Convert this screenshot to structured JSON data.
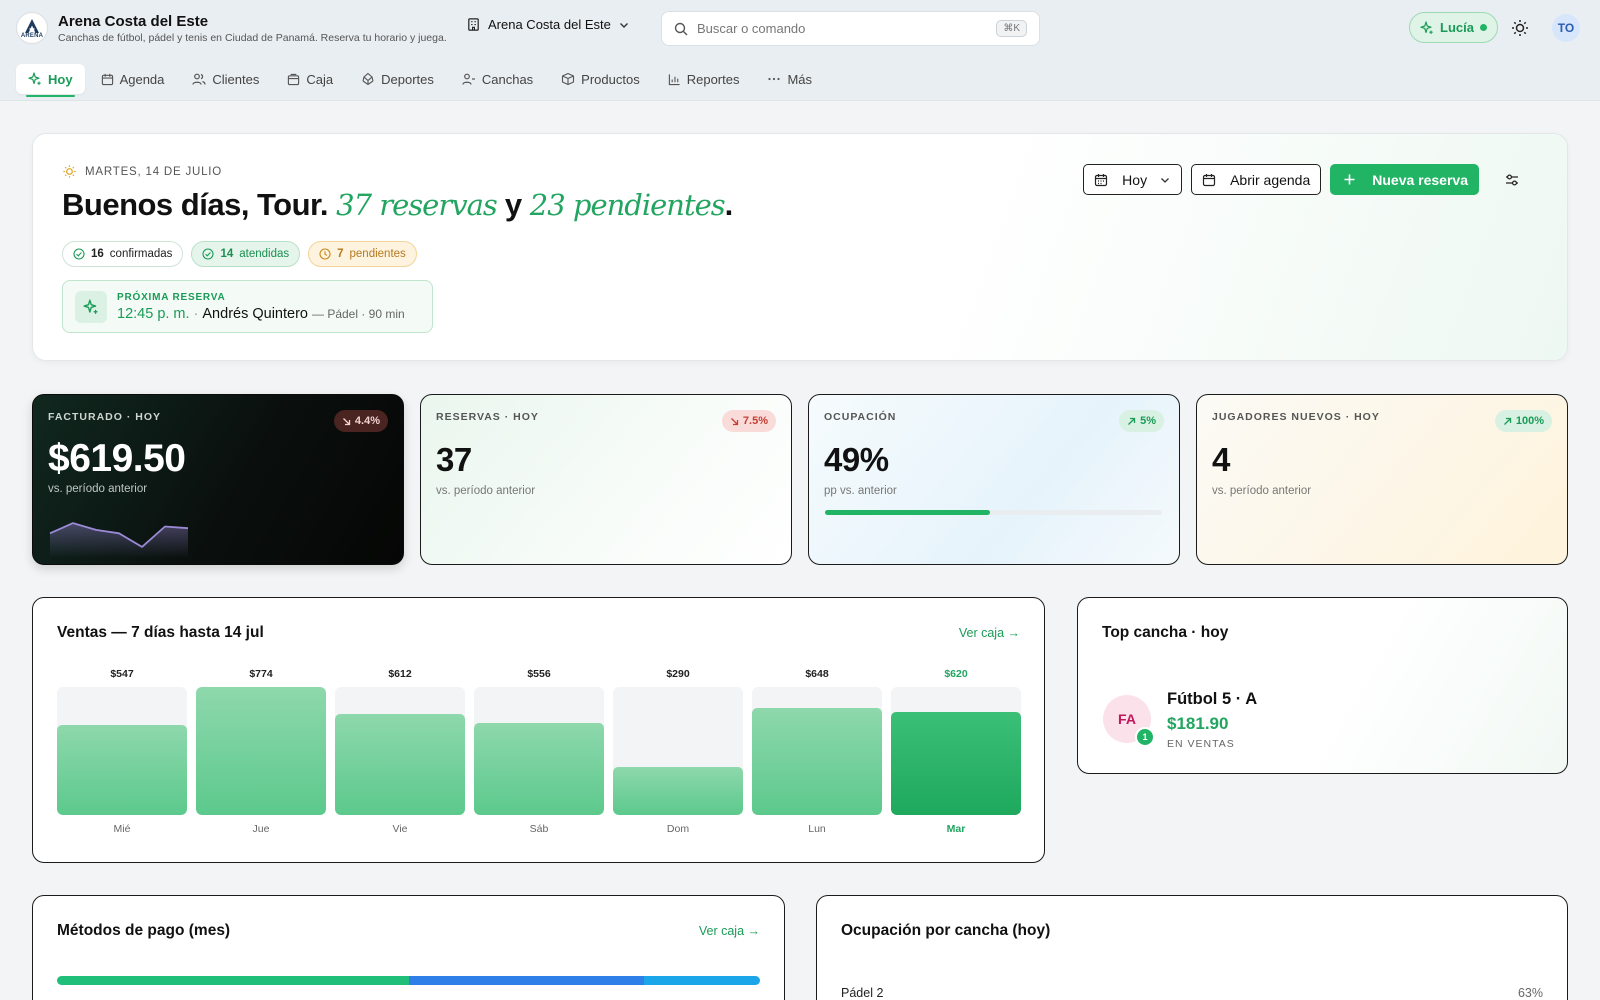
{
  "brand": {
    "title": "Arena Costa del Este",
    "subtitle": "Canchas de fútbol, pádel y tenis en Ciudad de Panamá. Reserva tu horario y juega.",
    "logo_text": "ARENA"
  },
  "venue_selector": {
    "value": "Arena Costa del Este"
  },
  "search": {
    "placeholder": "Buscar o comando",
    "shortcut": "⌘K"
  },
  "assistant": {
    "label": "Lucía"
  },
  "user": {
    "initials": "TO"
  },
  "tabs": [
    {
      "label": "Hoy",
      "icon": "sparkle-icon",
      "active": true
    },
    {
      "label": "Agenda",
      "icon": "calendar-icon"
    },
    {
      "label": "Clientes",
      "icon": "users-icon"
    },
    {
      "label": "Caja",
      "icon": "register-icon"
    },
    {
      "label": "Deportes",
      "icon": "ball-icon"
    },
    {
      "label": "Canchas",
      "icon": "court-icon"
    },
    {
      "label": "Productos",
      "icon": "box-icon"
    },
    {
      "label": "Reportes",
      "icon": "chart-icon"
    },
    {
      "label": "Más",
      "icon": "more-icon"
    }
  ],
  "hero": {
    "date": "MARTES, 14 DE JULIO",
    "greeting": "Buenos días, Tour.",
    "reservas": "37 reservas",
    "connector": "y",
    "pendientes": "23 pendientes",
    "period": ".",
    "chips": [
      {
        "count": "16",
        "label": "confirmadas"
      },
      {
        "count": "14",
        "label": "atendidas"
      },
      {
        "count": "7",
        "label": "pendientes"
      }
    ],
    "next": {
      "label": "PRÓXIMA RESERVA",
      "time": "12:45 p. m.",
      "sep": "·",
      "name": "Andrés Quintero",
      "meta": "— Pádel · 90 min"
    },
    "actions": {
      "period": "Hoy",
      "open_agenda": "Abrir agenda",
      "new_booking": "Nueva reserva"
    }
  },
  "kpis": [
    {
      "label": "FACTURADO · HOY",
      "value": "$619.50",
      "sub": "vs. período anterior",
      "delta": "4.4%",
      "trend": "down"
    },
    {
      "label": "RESERVAS · HOY",
      "value": "37",
      "sub": "vs. período anterior",
      "delta": "7.5%",
      "trend": "down"
    },
    {
      "label": "OCUPACIÓN",
      "value": "49%",
      "sub": "pp vs. anterior",
      "delta": "5%",
      "trend": "up",
      "progress": 0.49
    },
    {
      "label": "JUGADORES NUEVOS · HOY",
      "value": "4",
      "sub": "vs. período anterior",
      "delta": "100%",
      "trend": "up"
    }
  ],
  "sparkline": [
    0.55,
    0.85,
    0.65,
    0.55,
    0.15,
    0.75,
    0.7
  ],
  "sales": {
    "title": "Ventas — 7 días hasta 14 jul",
    "link": "Ver caja →"
  },
  "chart_data": {
    "type": "bar",
    "categories": [
      "Mié",
      "Jue",
      "Vie",
      "Sáb",
      "Dom",
      "Lun",
      "Mar"
    ],
    "values": [
      547,
      774,
      612,
      556,
      290,
      648,
      620
    ],
    "labels": [
      "$547",
      "$774",
      "$612",
      "$556",
      "$290",
      "$648",
      "$620"
    ],
    "highlight_index": 6,
    "ylim": [
      0,
      774
    ]
  },
  "top_court": {
    "title": "Top cancha · hoy",
    "initials": "FA",
    "rank": "1",
    "name": "Fútbol 5 · A",
    "amount": "$181.90",
    "caption": "EN VENTAS"
  },
  "payments": {
    "title": "Métodos de pago (mes)",
    "link": "Ver caja →",
    "segments": [
      {
        "share": 0.5,
        "color": "#1fbf7a"
      },
      {
        "share": 0.335,
        "color": "#2f7fe8"
      },
      {
        "share": 0.165,
        "color": "#1aa6e8"
      }
    ]
  },
  "occupancy": {
    "title": "Ocupación por cancha (hoy)",
    "rows": [
      {
        "name": "Pádel 2",
        "value": "63%"
      }
    ]
  },
  "colors": {
    "accent": "#22b465",
    "accent_text": "#1a9b57",
    "danger": "#c53d33"
  }
}
